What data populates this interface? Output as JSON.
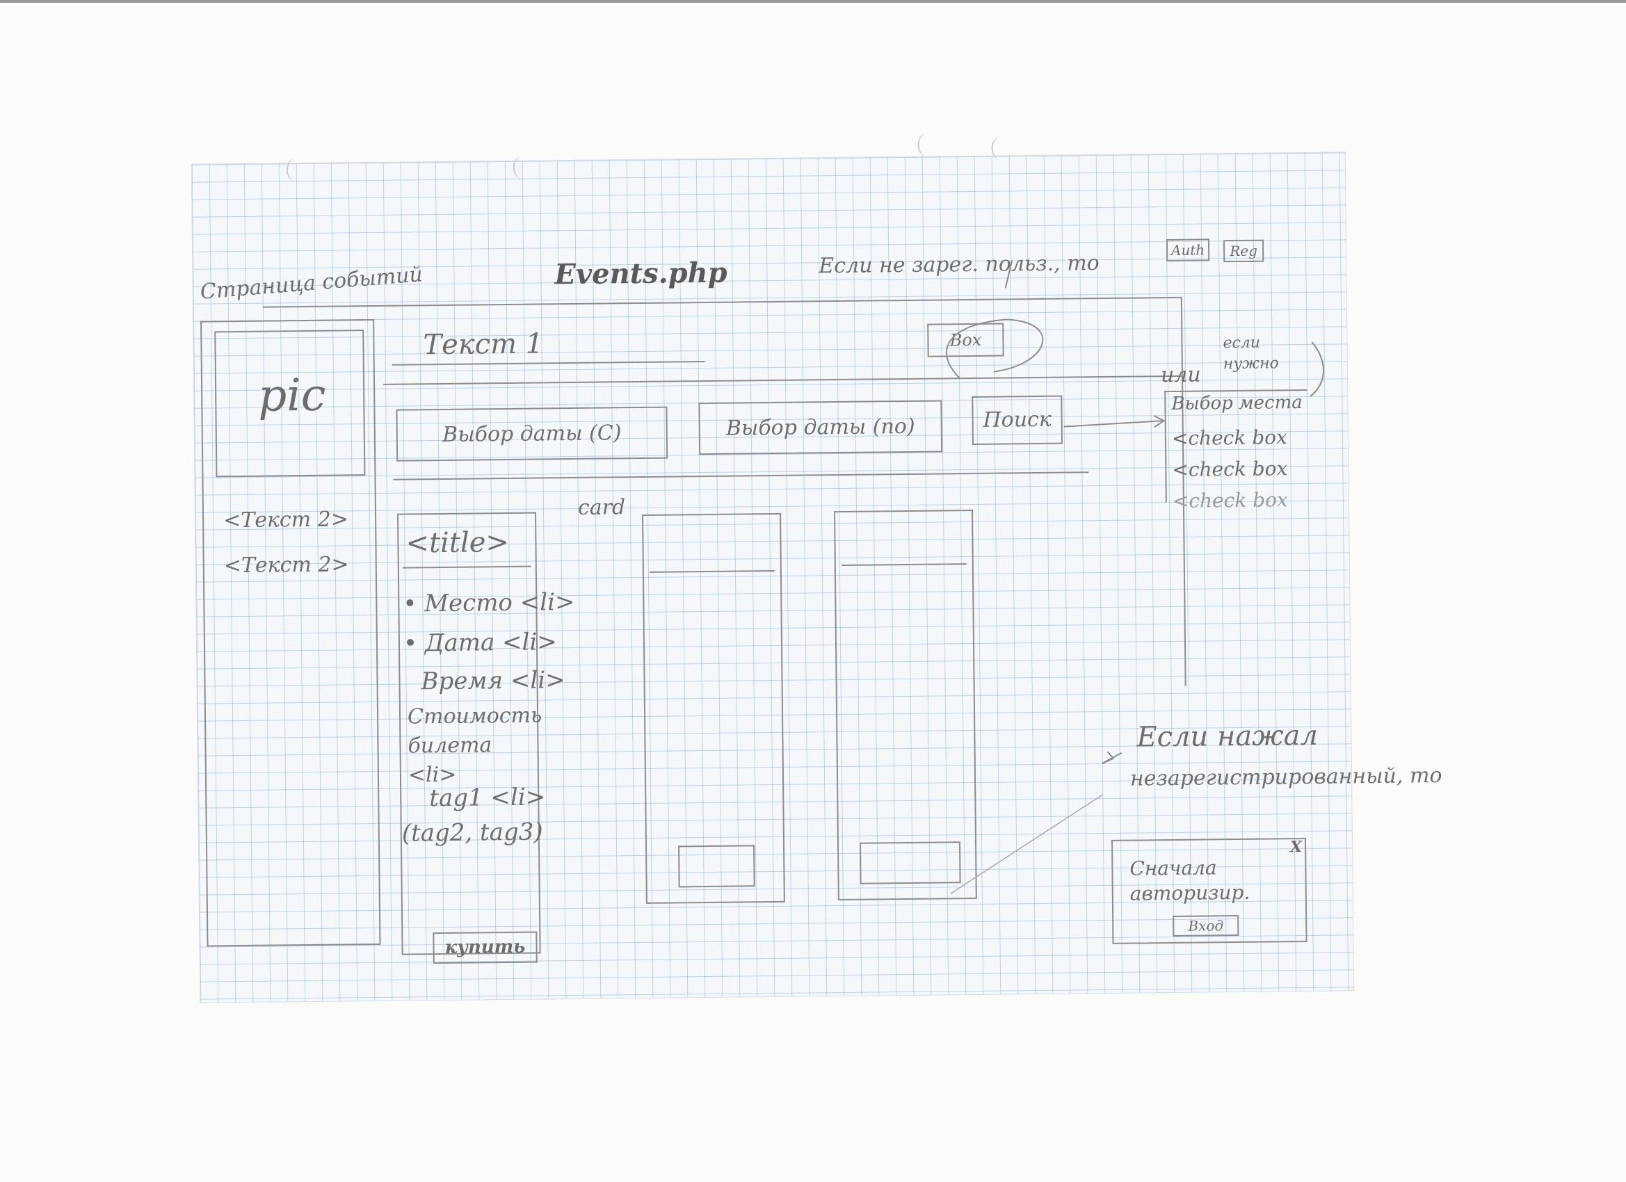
{
  "header": {
    "page_label": "Страница событий",
    "file_name": "Events.php",
    "if_not_registered": "Если не зарег. польз., то",
    "auth_button": "Auth",
    "reg_button": "Reg"
  },
  "top_bar": {
    "text1": "Текст 1",
    "box_label": "Box"
  },
  "sidebar": {
    "pic_label": "pic",
    "text_items": [
      "<Текст 2>",
      "<Текст 2>"
    ]
  },
  "filters": {
    "date_from": "Выбор даты (С)",
    "date_to": "Выбор даты (по)",
    "search_button": "Поиск"
  },
  "side_note": {
    "or_label": "или",
    "if_desired": "если нужно",
    "place_choice_title": "Выбор места",
    "checkboxes": [
      "<check box",
      "<check box",
      "<check box"
    ]
  },
  "card": {
    "card_label": "card",
    "title": "<title>",
    "items": [
      "• Место <li>",
      "• Дата <li>",
      "Время <li>",
      "Стоимость билета <li>",
      "tag1 <li>",
      "(tag2, tag3)"
    ],
    "buy_button": "купить"
  },
  "auth_note": {
    "if_clicked": "Если нажал",
    "unregistered": "незарегистрированный, то",
    "message": "Сначала авторизир.",
    "close_mark": "X",
    "button": "Вход"
  }
}
